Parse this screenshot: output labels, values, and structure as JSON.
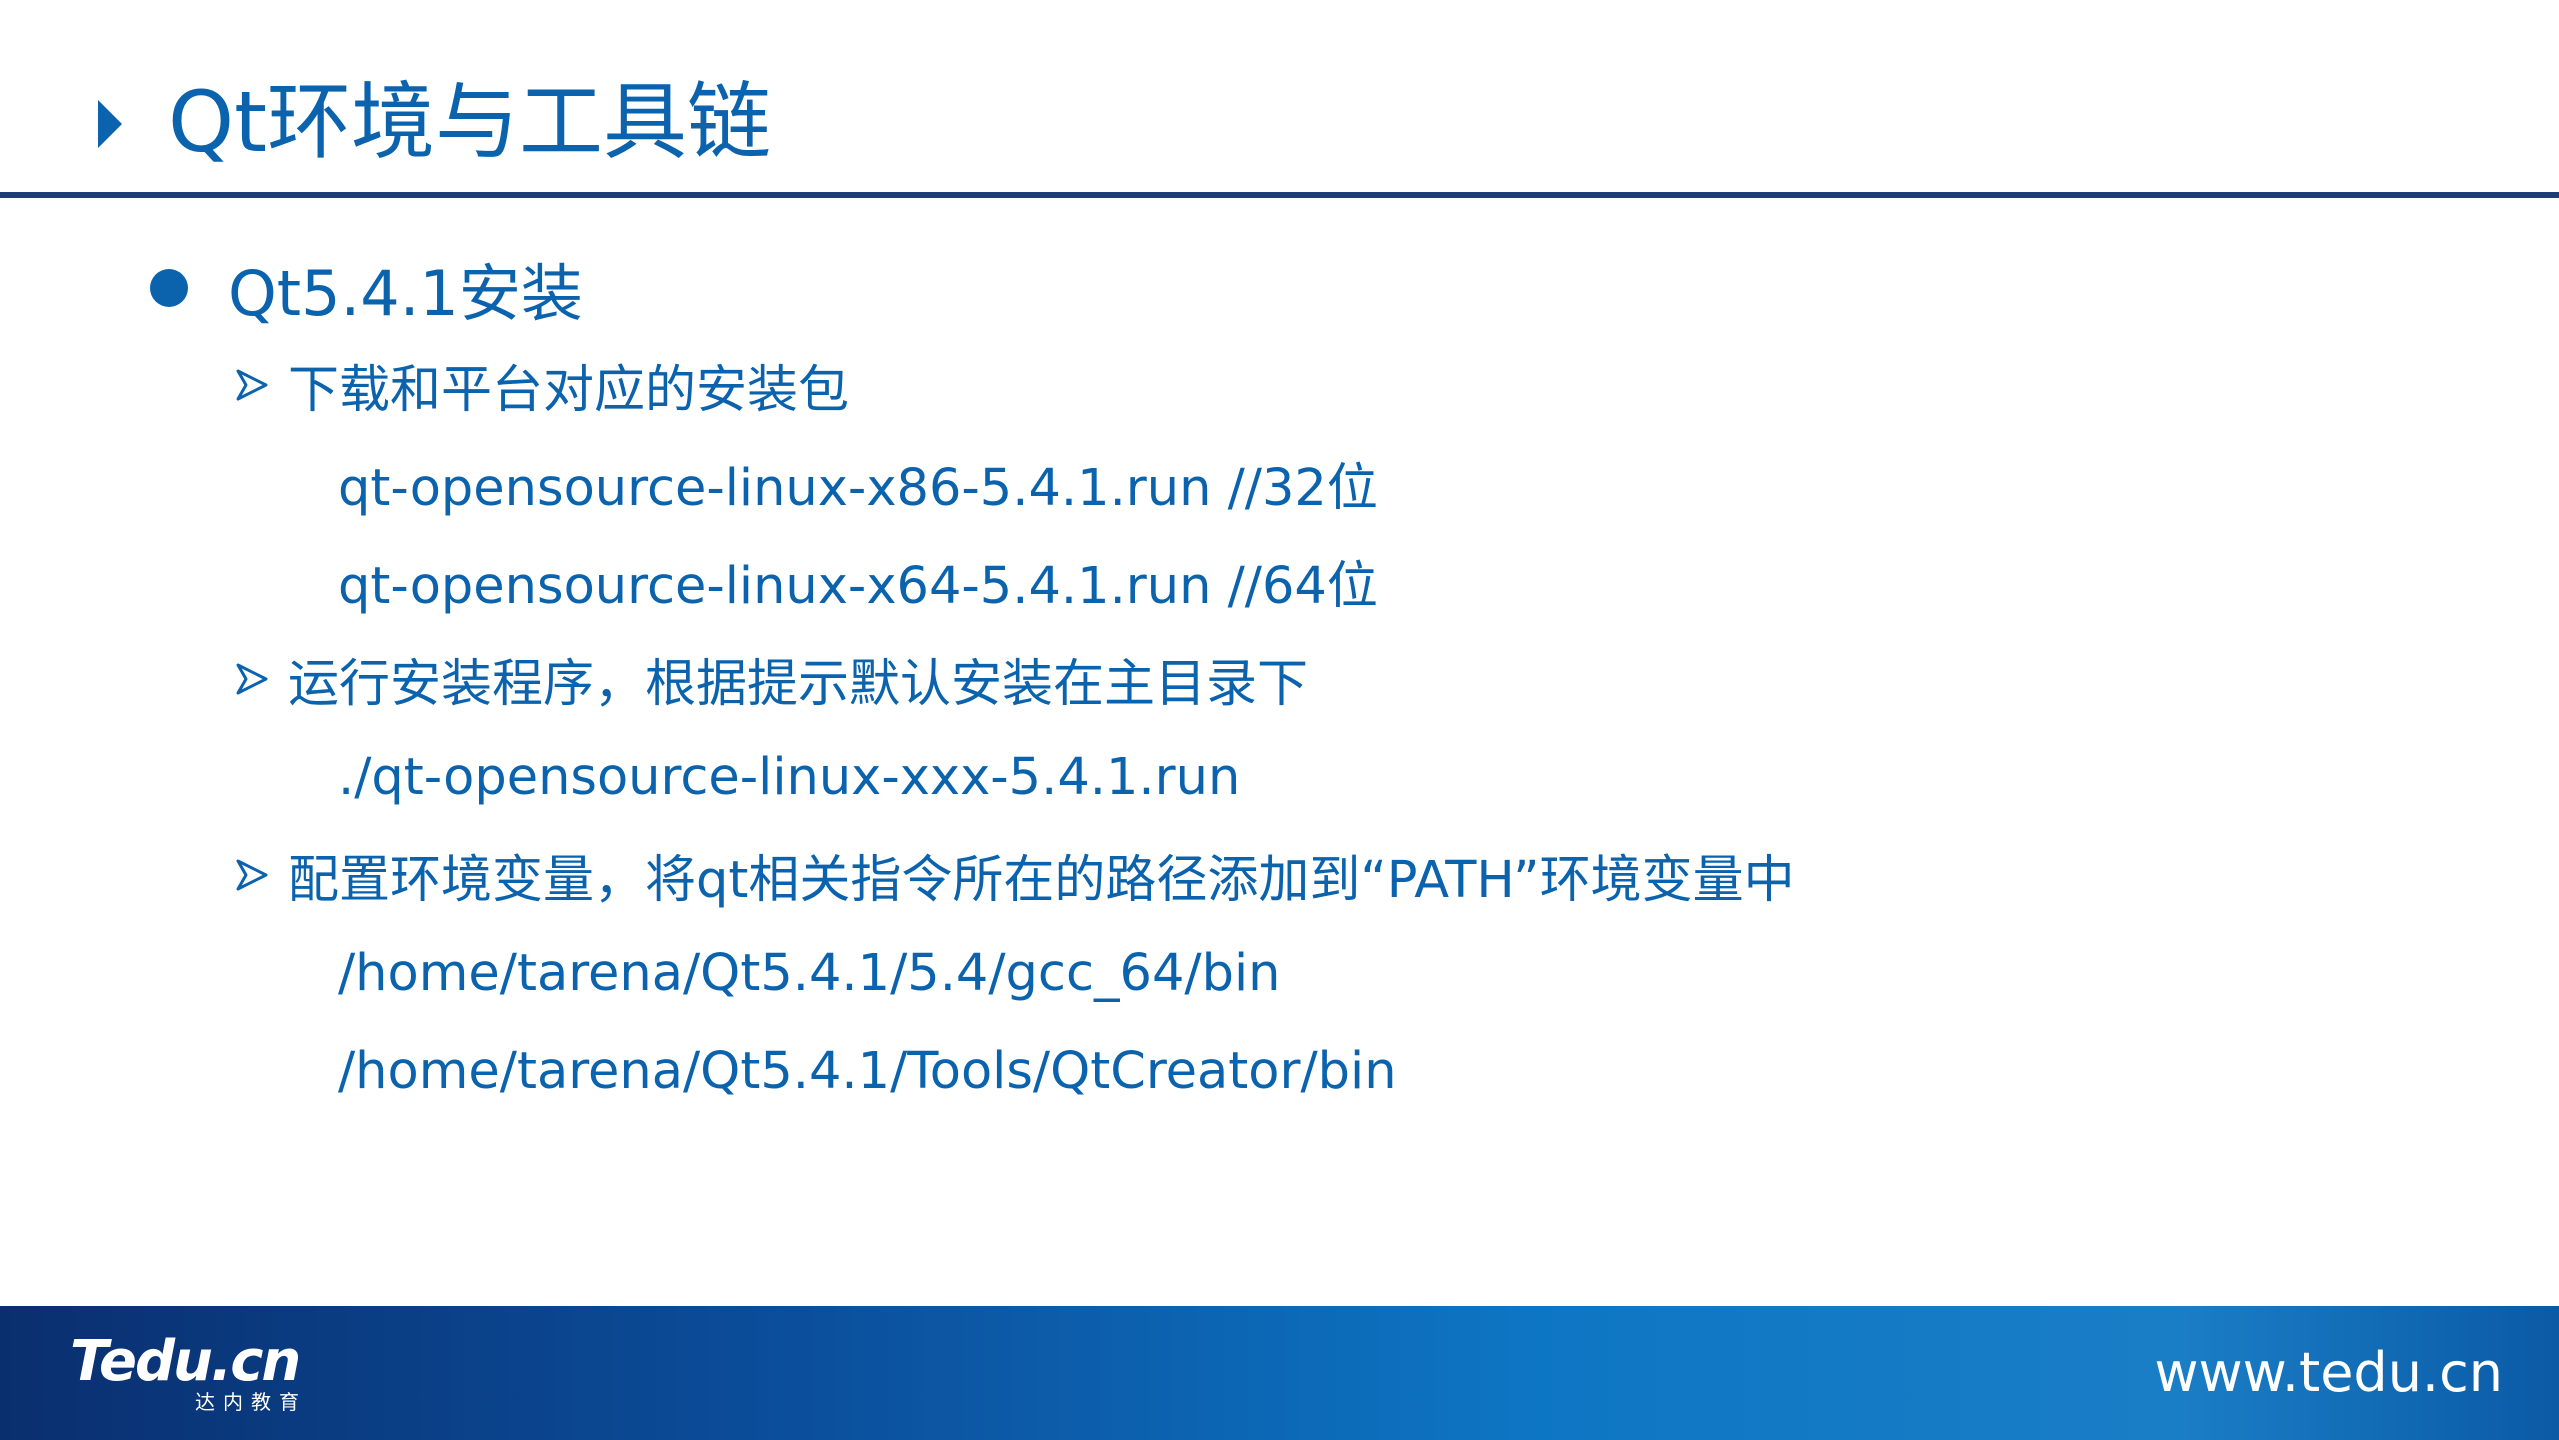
{
  "slide": {
    "title": "Qt环境与工具链"
  },
  "content": {
    "heading": "Qt5.4.1安装",
    "lines": [
      {
        "level": 2,
        "text": "下载和平台对应的安装包"
      },
      {
        "level": 3,
        "text": "qt-opensource-linux-x86-5.4.1.run //32位"
      },
      {
        "level": 3,
        "text": "qt-opensource-linux-x64-5.4.1.run //64位"
      },
      {
        "level": 2,
        "text": "运行安装程序，根据提示默认安装在主目录下"
      },
      {
        "level": 3,
        "text": "./qt-opensource-linux-xxx-5.4.1.run"
      },
      {
        "level": 2,
        "text": "配置环境变量，将qt相关指令所在的路径添加到“PATH”环境变量中"
      },
      {
        "level": 3,
        "text": "/home/tarena/Qt5.4.1/5.4/gcc_64/bin"
      },
      {
        "level": 3,
        "text": "/home/tarena/Qt5.4.1/Tools/QtCreator/bin"
      }
    ]
  },
  "footer": {
    "logo_text": "Tedu.cn",
    "logo_sub": "达内教育",
    "url": "www.tedu.cn"
  },
  "colors": {
    "accent": "#0b63ad",
    "rule": "#1f3c7a",
    "footer_dark": "#0a2f6f",
    "footer_light": "#1a7ec6"
  },
  "icons": [
    "triangle-right-icon",
    "bullet-dot-icon",
    "chevron-arrow-icon"
  ]
}
